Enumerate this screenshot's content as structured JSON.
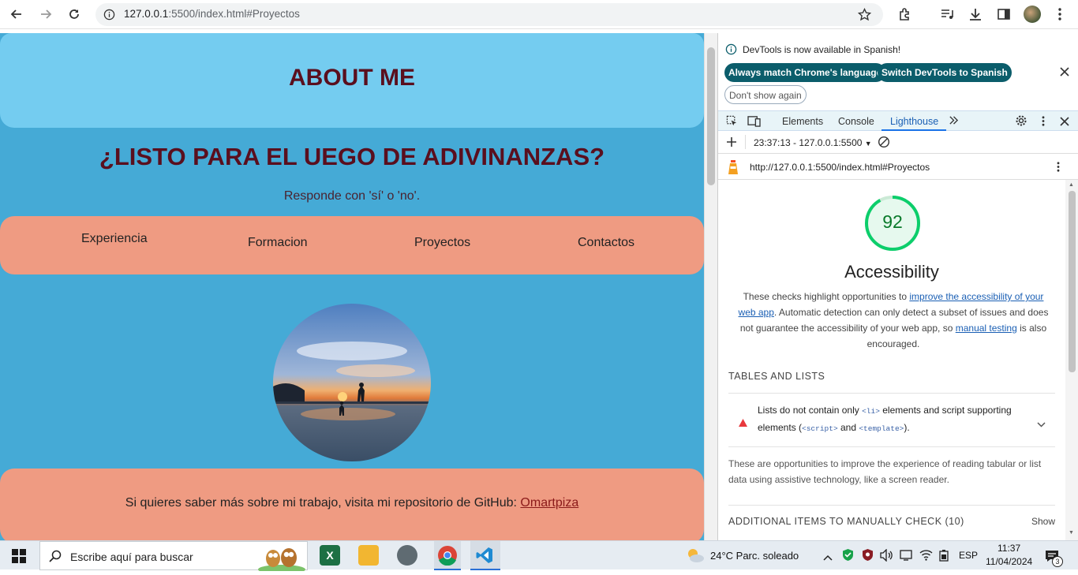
{
  "browser": {
    "url_host": "127.0.0.1",
    "url_rest": ":5500/index.html#Proyectos"
  },
  "page": {
    "about_title": "ABOUT ME",
    "game_title": "¿LISTO PARA EL UEGO DE ADIVINANZAS?",
    "game_subtitle": "Responde con 'sí' o 'no'.",
    "nav": [
      "Experiencia",
      "Formacion",
      "Proyectos",
      "Contactos"
    ],
    "footer_text": "Si quieres saber más sobre mi trabajo, visita mi repositorio de GitHub: ",
    "footer_link": "Omartpiza"
  },
  "devtools": {
    "banner": "DevTools is now available in Spanish!",
    "btn_match": "Always match Chrome's language",
    "btn_switch": "Switch DevTools to Spanish",
    "btn_dont_show": "Don't show again",
    "tabs": [
      "Elements",
      "Console",
      "Lighthouse"
    ],
    "report_select": "23:37:13 - 127.0.0.1:5500",
    "report_url": "http://127.0.0.1:5500/index.html#Proyectos",
    "score": "92",
    "score_fraction": 0.92,
    "category": "Accessibility",
    "desc_1": "These checks highlight opportunities to ",
    "desc_link_1": "improve the accessibility of your web app",
    "desc_2": ". Automatic detection can only detect a subset of issues and does not guarantee the accessibility of your web app, so ",
    "desc_link_2": "manual testing",
    "desc_3": " is also encouraged.",
    "section_tables": "TABLES AND LISTS",
    "audit_1": "Lists do not contain only ",
    "audit_code_1": "<li>",
    "audit_2": " elements and script supporting elements (",
    "audit_code_2": "<script>",
    "audit_3": " and ",
    "audit_code_3": "<template>",
    "audit_4": ").",
    "opportunity_text": "These are opportunities to improve the experience of reading tabular or list data using assistive technology, like a screen reader.",
    "section_manual": "ADDITIONAL ITEMS TO MANUALLY CHECK",
    "manual_count": "(10)",
    "show_label": "Show"
  },
  "taskbar": {
    "search_placeholder": "Escribe aquí para buscar",
    "weather": "24°C  Parc. soleado",
    "lang": "ESP",
    "time": "11:37",
    "date": "11/04/2024",
    "notif_count": "3"
  },
  "colors": {
    "page_bg": "#45aad6",
    "header_bg": "#74ccf0",
    "nav_bg": "#ef9b82",
    "title_color": "#5a0f1e",
    "score_green": "#0cce6b"
  }
}
